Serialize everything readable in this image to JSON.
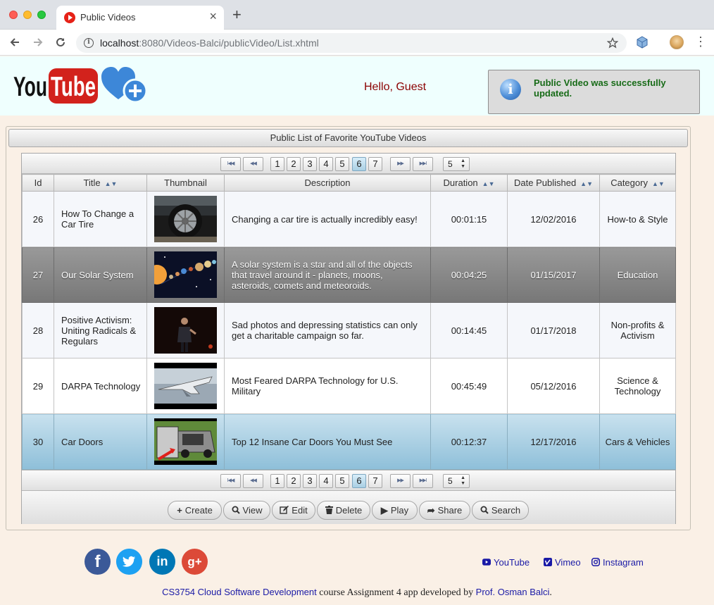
{
  "browser": {
    "tab_title": "Public Videos",
    "url_host": "localhost",
    "url_rest": ":8080/Videos-Balci/publicVideo/List.xhtml",
    "close_glyph": "×",
    "newtab_glyph": "+"
  },
  "header": {
    "greeting": "Hello, Guest",
    "message": "Public Video was successfully updated."
  },
  "panel": {
    "title": "Public List of Favorite YouTube Videos"
  },
  "paginator": {
    "pages": [
      "1",
      "2",
      "3",
      "4",
      "5",
      "6",
      "7"
    ],
    "current_page": "6",
    "rows_per_page": "5",
    "first": "I◀◀",
    "prev": "◀◀",
    "next": "▶▶",
    "last": "▶▶I"
  },
  "table": {
    "columns": [
      "Id",
      "Title",
      "Thumbnail",
      "Description",
      "Duration",
      "Date Published",
      "Category"
    ],
    "rows": [
      {
        "id": "26",
        "title": "How To Change a Car Tire",
        "description": "Changing a car tire is actually incredibly easy!",
        "duration": "00:01:15",
        "date": "12/02/2016",
        "category": "How-to & Style",
        "thumb": "car-tire"
      },
      {
        "id": "27",
        "title": "Our Solar System",
        "description": "A solar system is a star and all of the objects that travel around it - planets, moons, asteroids, comets and meteoroids.",
        "duration": "00:04:25",
        "date": "01/15/2017",
        "category": "Education",
        "thumb": "solar-system"
      },
      {
        "id": "28",
        "title": "Positive Activism: Uniting Radicals & Regulars",
        "description": "Sad photos and depressing statistics can only get a charitable campaign so far.",
        "duration": "00:14:45",
        "date": "01/17/2018",
        "category": "Non-profits & Activism",
        "thumb": "speaker-stage"
      },
      {
        "id": "29",
        "title": "DARPA Technology",
        "description": "Most Feared DARPA Technology for U.S. Military",
        "duration": "00:45:49",
        "date": "05/12/2016",
        "category": "Science & Technology",
        "thumb": "aircraft"
      },
      {
        "id": "30",
        "title": "Car Doors",
        "description": "Top 12 Insane Car Doors You Must See",
        "duration": "00:12:37",
        "date": "12/17/2016",
        "category": "Cars & Vehicles",
        "thumb": "car-doors"
      }
    ]
  },
  "actions": {
    "create": "Create",
    "view": "View",
    "edit": "Edit",
    "delete": "Delete",
    "play": "Play",
    "share": "Share",
    "search": "Search"
  },
  "footer": {
    "facebook_glyph": "f",
    "linkedin_glyph": "in",
    "googleplus_glyph": "g+",
    "youtube": "YouTube",
    "vimeo": "Vimeo",
    "instagram": "Instagram",
    "course_link": "CS3754 Cloud Software Development",
    "credit_middle": " course Assignment 4 app developed by ",
    "author_link": "Prof. Osman Balci",
    "credit_end": "."
  },
  "colors": {
    "header_bg": "#effffe",
    "page_bg": "#faf0e6",
    "greeting": "#8b0000",
    "message": "#176b17",
    "link": "#1a1aa6"
  }
}
